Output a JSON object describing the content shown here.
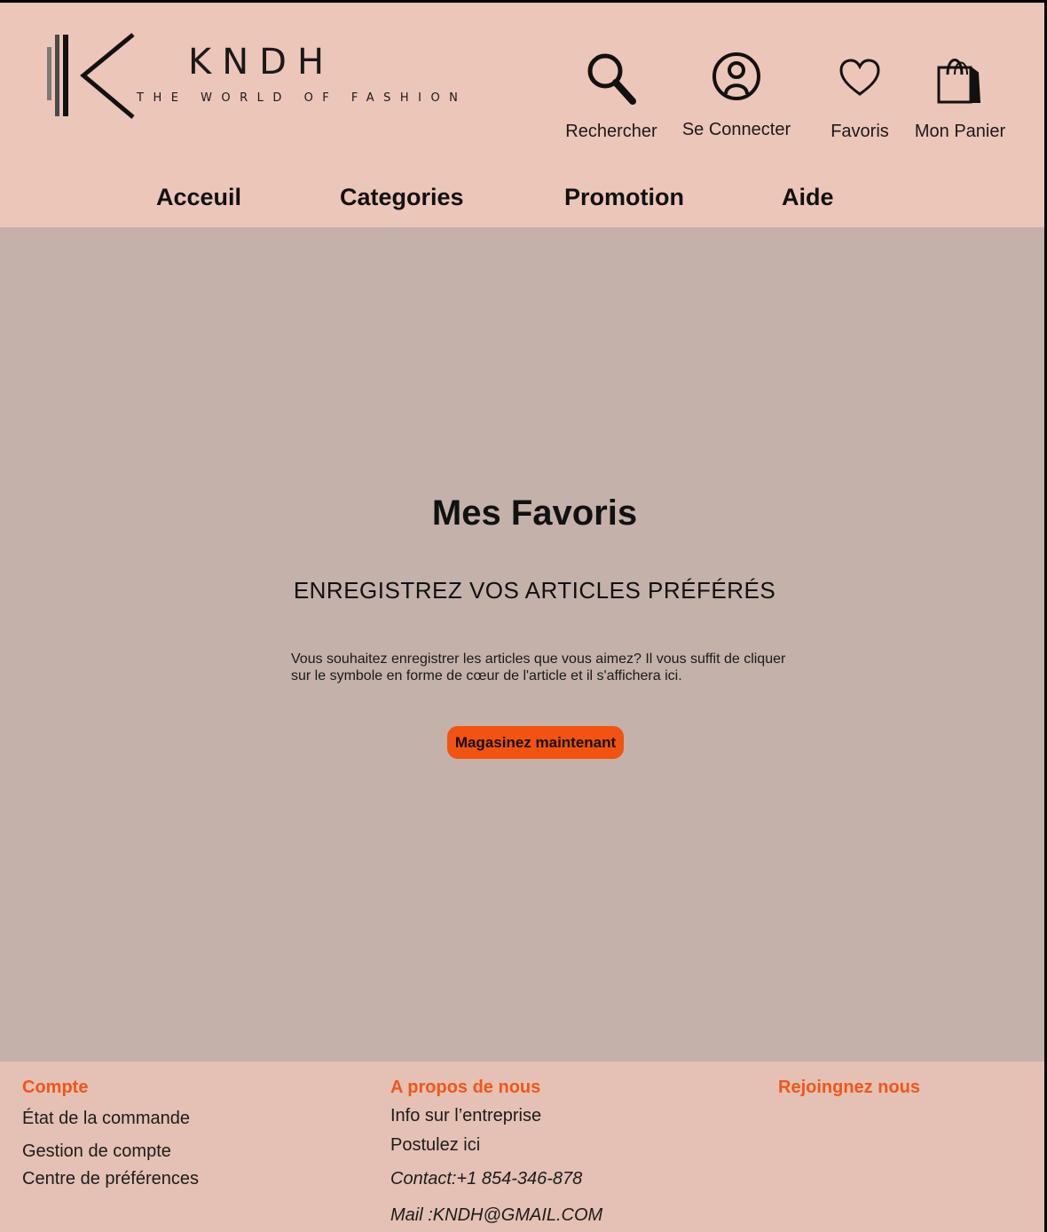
{
  "brand": {
    "name": "KNDH",
    "tagline": "THE WORLD OF FASHION"
  },
  "header_actions": [
    {
      "label": "Rechercher",
      "icon": "search-icon"
    },
    {
      "label": "Se Connecter",
      "icon": "user-icon"
    },
    {
      "label": "Favoris",
      "icon": "heart-icon"
    },
    {
      "label": "Mon Panier",
      "icon": "shopping-bag-icon"
    }
  ],
  "nav": {
    "items": [
      "Acceuil",
      "Categories",
      "Promotion",
      "Aide"
    ]
  },
  "main": {
    "title": "Mes Favoris",
    "subtitle": "ENREGISTREZ VOS ARTICLES PRÉFÉRÉS",
    "description": "Vous souhaitez enregistrer les articles que vous aimez? Il vous suffit de cliquer sur le symbole en forme de cœur de l'article et il s'affichera ici.",
    "cta_label": "Magasinez maintenant"
  },
  "footer": {
    "account": {
      "heading": "Compte",
      "links": [
        "État de la commande",
        "Gestion de compte",
        "Centre de préférences"
      ]
    },
    "about": {
      "heading": "A propos de nous",
      "links": [
        "Info sur l’entreprise",
        "Postulez ici"
      ],
      "contact": "Contact:+1 854-346-878",
      "mail": "Mail :KNDH@GMAIL.COM"
    },
    "join": {
      "heading": "Rejoingnez nous"
    }
  },
  "colors": {
    "header_bg": "#ecc6b9",
    "content_bg": "#c3b1aa",
    "footer_bg": "#e4c1b4",
    "accent": "#f4520f",
    "footer_heading": "#f0561a"
  }
}
